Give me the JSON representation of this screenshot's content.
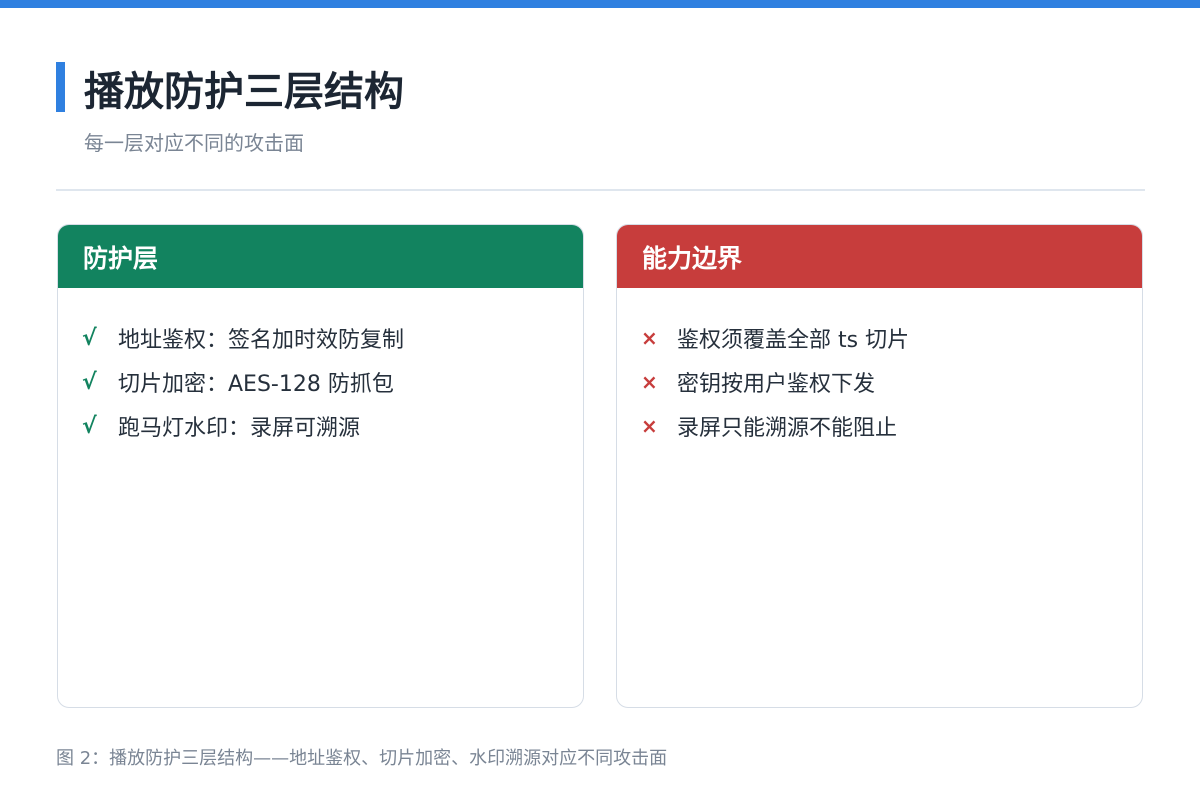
{
  "header": {
    "title": "播放防护三层结构",
    "subtitle": "每一层对应不同的攻击面"
  },
  "colors": {
    "accent": "#2f80e0",
    "protection_header": "#12835f",
    "boundary_header": "#c73d3c"
  },
  "protection_panel": {
    "title": "防护层",
    "mark_icon": "check-icon",
    "items": [
      {
        "mark": "√",
        "text": "地址鉴权：签名加时效防复制"
      },
      {
        "mark": "√",
        "text": "切片加密：AES-128 防抓包"
      },
      {
        "mark": "√",
        "text": "跑马灯水印：录屏可溯源"
      }
    ]
  },
  "boundary_panel": {
    "title": "能力边界",
    "mark_icon": "cross-icon",
    "items": [
      {
        "mark": "×",
        "text": "鉴权须覆盖全部 ts 切片"
      },
      {
        "mark": "×",
        "text": "密钥按用户鉴权下发"
      },
      {
        "mark": "×",
        "text": "录屏只能溯源不能阻止"
      }
    ]
  },
  "caption": "图 2：播放防护三层结构——地址鉴权、切片加密、水印溯源对应不同攻击面"
}
